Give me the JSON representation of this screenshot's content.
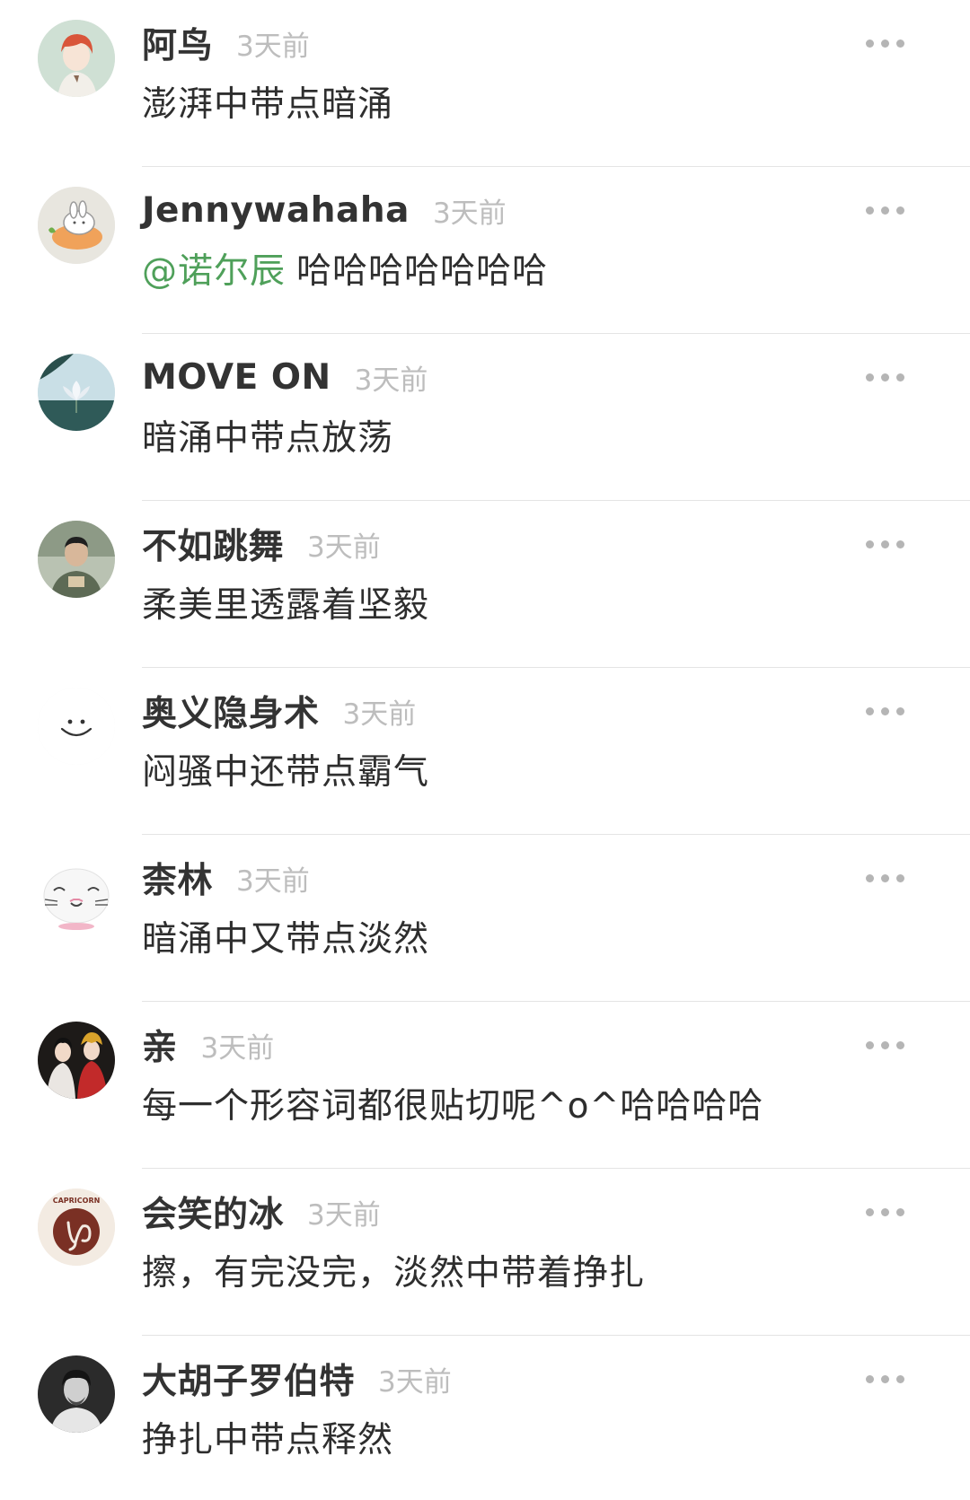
{
  "comments": [
    {
      "username": "阿鸟",
      "time": "3天前",
      "content": "澎湃中带点暗涌",
      "avatar": "avatar-red-hair-anime-boy"
    },
    {
      "username": "Jennywahaha",
      "time": "3天前",
      "mention": "@诺尔辰",
      "content": "哈哈哈哈哈哈哈",
      "avatar": "avatar-bunny-on-carrot"
    },
    {
      "username": "MOVE ON",
      "time": "3天前",
      "content": "暗涌中带点放荡",
      "avatar": "avatar-lotus-flower"
    },
    {
      "username": "不如跳舞",
      "time": "3天前",
      "content": "柔美里透露着坚毅",
      "avatar": "avatar-man-photo"
    },
    {
      "username": "奥义隐身术",
      "time": "3天前",
      "content": "闷骚中还带点霸气",
      "avatar": "avatar-smiley-face"
    },
    {
      "username": "柰林",
      "time": "3天前",
      "content": "暗涌中又带点淡然",
      "avatar": "avatar-white-cat"
    },
    {
      "username": "亲",
      "time": "3天前",
      "content": "每一个形容词都很贴切呢^o^哈哈哈哈",
      "avatar": "avatar-costume-couple"
    },
    {
      "username": "会笑的冰",
      "time": "3天前",
      "content": "擦，有完没完，淡然中带着挣扎",
      "avatar": "avatar-capricorn-badge",
      "avatar_text": "CAPRICORN"
    },
    {
      "username": "大胡子罗伯特",
      "time": "3天前",
      "content": "挣扎中带点释然",
      "avatar": "avatar-bw-portrait"
    }
  ],
  "icons": {
    "more": "more-dots-icon"
  },
  "colors": {
    "mention": "#4fa05a",
    "time": "#bdbdbd",
    "divider": "#e4e4e4"
  }
}
